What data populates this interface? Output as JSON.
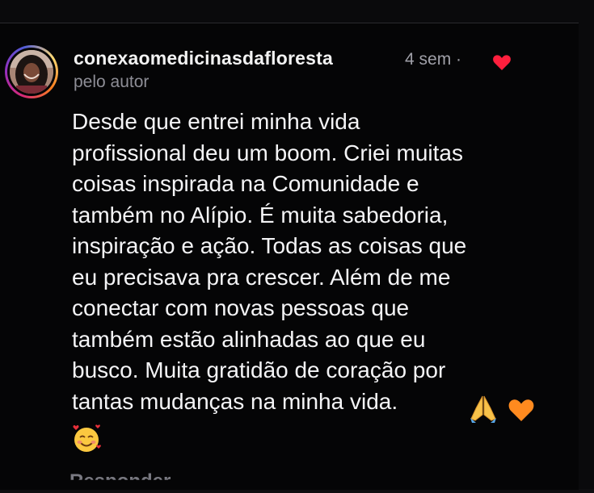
{
  "comment": {
    "username": "conexaomedicinasdafloresta",
    "age": "4 sem",
    "separator": "·",
    "author_tag": "pelo autor",
    "text_lines": [
      "Desde que entrei minha vida",
      "profissional deu um boom. Criei muitas",
      "coisas inspirada na Comunidade e",
      "também no Alípio. É muita sabedoria,",
      "inspiração e ação. Todas as coisas que",
      "eu precisava pra crescer. Além de me",
      "conectar com novas pessoas que",
      "também estão alinhadas ao que eu",
      "busco. Muita gratidão de coração por",
      "tantas mudanças na minha vida."
    ],
    "emojis": [
      "folded-hands-emoji",
      "orange-heart-emoji",
      "smiling-face-with-hearts-emoji"
    ],
    "liked_by_author_icon": "red-heart-icon",
    "reply_label": "Responder"
  },
  "colors": {
    "background": "#050506",
    "text": "#f4f4f6",
    "secondary_text": "#a0a0a8",
    "heart": "#ff1f3d",
    "orange_heart": "#ff8a1f"
  }
}
